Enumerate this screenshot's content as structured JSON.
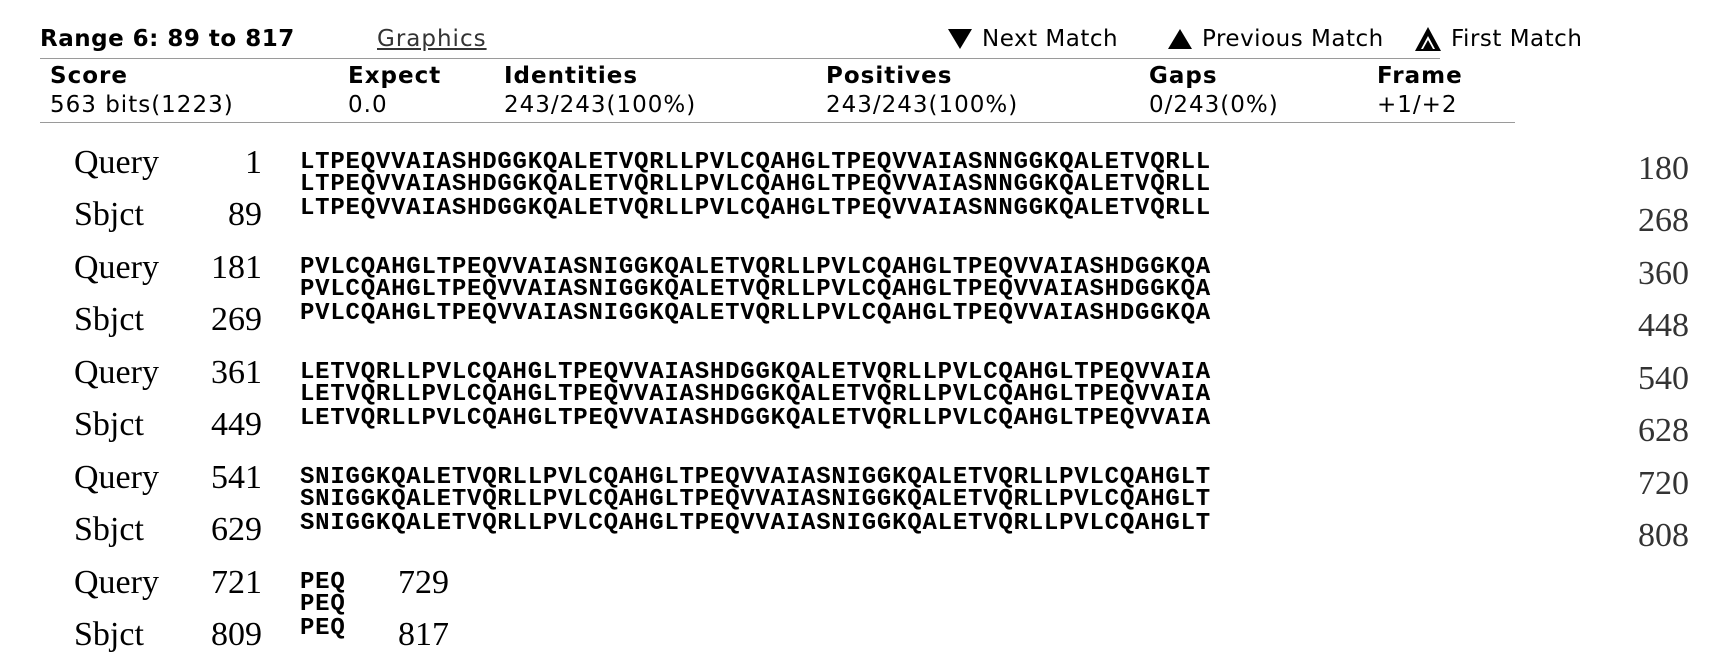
{
  "header": {
    "range_title": "Range 6: 89 to 817",
    "graphics_link": "Graphics",
    "next_match": "Next Match",
    "previous_match": "Previous Match",
    "first_match": "First Match"
  },
  "stats": {
    "score_label": "Score",
    "score_value": "563 bits(1223)",
    "expect_label": "Expect",
    "expect_value": "0.0",
    "identities_label": "Identities",
    "identities_value": "243/243(100%)",
    "positives_label": "Positives",
    "positives_value": "243/243(100%)",
    "gaps_label": "Gaps",
    "gaps_value": "0/243(0%)",
    "frame_label": "Frame",
    "frame_value": "+1/+2"
  },
  "alignment": {
    "query_label": "Query",
    "sbjct_label": "Sbjct",
    "blocks": [
      {
        "q_start": "1",
        "q_seq": "LTPEQVVAIASHDGGKQALETVQRLLPVLCQAHGLTPEQVVAIASNNGGKQALETVQRLL",
        "q_end": "180",
        "match": "LTPEQVVAIASHDGGKQALETVQRLLPVLCQAHGLTPEQVVAIASNNGGKQALETVQRLL",
        "s_start": "89",
        "s_seq": "LTPEQVVAIASHDGGKQALETVQRLLPVLCQAHGLTPEQVVAIASNNGGKQALETVQRLL",
        "s_end": "268"
      },
      {
        "q_start": "181",
        "q_seq": "PVLCQAHGLTPEQVVAIASNIGGKQALETVQRLLPVLCQAHGLTPEQVVAIASHDGGKQA",
        "q_end": "360",
        "match": "PVLCQAHGLTPEQVVAIASNIGGKQALETVQRLLPVLCQAHGLTPEQVVAIASHDGGKQA",
        "s_start": "269",
        "s_seq": "PVLCQAHGLTPEQVVAIASNIGGKQALETVQRLLPVLCQAHGLTPEQVVAIASHDGGKQA",
        "s_end": "448"
      },
      {
        "q_start": "361",
        "q_seq": "LETVQRLLPVLCQAHGLTPEQVVAIASHDGGKQALETVQRLLPVLCQAHGLTPEQVVAIA",
        "q_end": "540",
        "match": "LETVQRLLPVLCQAHGLTPEQVVAIASHDGGKQALETVQRLLPVLCQAHGLTPEQVVAIA",
        "s_start": "449",
        "s_seq": "LETVQRLLPVLCQAHGLTPEQVVAIASHDGGKQALETVQRLLPVLCQAHGLTPEQVVAIA",
        "s_end": "628"
      },
      {
        "q_start": "541",
        "q_seq": "SNIGGKQALETVQRLLPVLCQAHGLTPEQVVAIASNIGGKQALETVQRLLPVLCQAHGLT",
        "q_end": "720",
        "match": "SNIGGKQALETVQRLLPVLCQAHGLTPEQVVAIASNIGGKQALETVQRLLPVLCQAHGLT",
        "s_start": "629",
        "s_seq": "SNIGGKQALETVQRLLPVLCQAHGLTPEQVVAIASNIGGKQALETVQRLLPVLCQAHGLT",
        "s_end": "808"
      },
      {
        "q_start": "721",
        "q_seq": "PEQ",
        "q_end": "729",
        "match": "PEQ",
        "s_start": "809",
        "s_seq": "PEQ",
        "s_end": "817"
      }
    ]
  }
}
